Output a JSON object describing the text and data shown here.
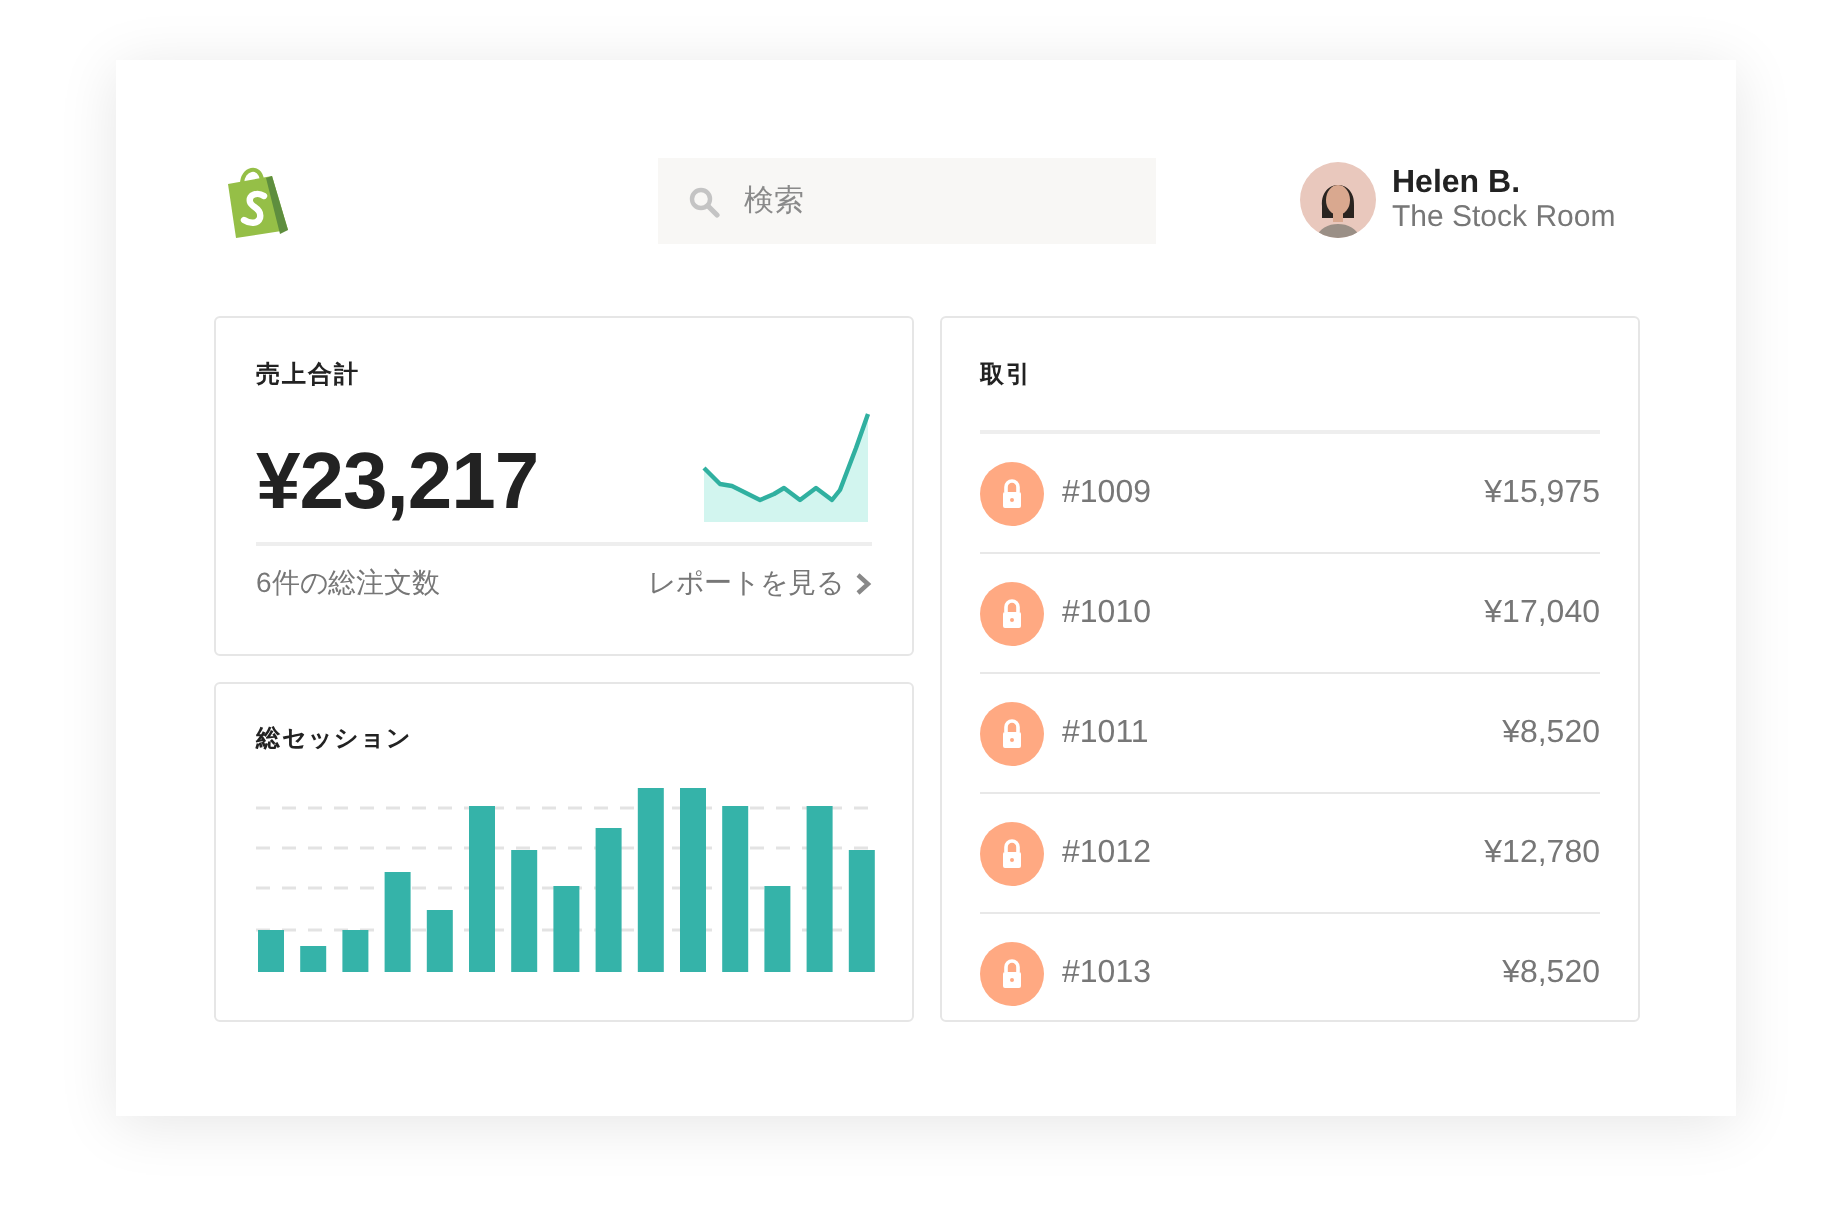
{
  "search": {
    "placeholder": "検索"
  },
  "user": {
    "name": "Helen B.",
    "store": "The Stock Room"
  },
  "sales": {
    "title": "売上合計",
    "amount": "¥23,217",
    "orders": "6件の総注文数",
    "report_link": "レポートを見る"
  },
  "sessions": {
    "title": "総セッション"
  },
  "transactions": {
    "title": "取引",
    "rows": [
      {
        "order": "#1009",
        "amount": "¥15,975"
      },
      {
        "order": "#1010",
        "amount": "¥17,040"
      },
      {
        "order": "#1011",
        "amount": "¥8,520"
      },
      {
        "order": "#1012",
        "amount": "¥12,780"
      },
      {
        "order": "#1013",
        "amount": "¥8,520"
      }
    ]
  }
}
